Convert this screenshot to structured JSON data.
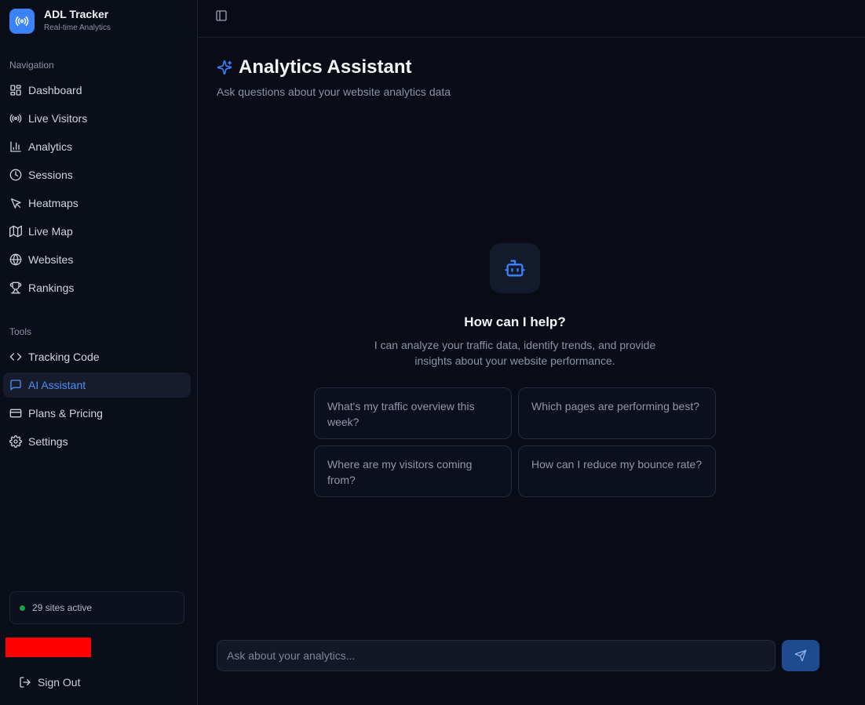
{
  "brand": {
    "name": "ADL Tracker",
    "subtitle": "Real-time Analytics"
  },
  "sidebar": {
    "navigation_label": "Navigation",
    "nav_items": [
      {
        "label": "Dashboard",
        "icon": "grid-icon"
      },
      {
        "label": "Live Visitors",
        "icon": "radio-icon"
      },
      {
        "label": "Analytics",
        "icon": "bar-chart-icon"
      },
      {
        "label": "Sessions",
        "icon": "clock-icon"
      },
      {
        "label": "Heatmaps",
        "icon": "cursor-icon"
      },
      {
        "label": "Live Map",
        "icon": "map-icon"
      },
      {
        "label": "Websites",
        "icon": "globe-icon"
      },
      {
        "label": "Rankings",
        "icon": "trophy-icon"
      }
    ],
    "tools_label": "Tools",
    "tool_items": [
      {
        "label": "Tracking Code",
        "icon": "code-icon"
      },
      {
        "label": "AI Assistant",
        "icon": "message-icon",
        "active": true
      },
      {
        "label": "Plans & Pricing",
        "icon": "credit-card-icon"
      },
      {
        "label": "Settings",
        "icon": "gear-icon"
      }
    ],
    "sites_status": "29 sites active",
    "redacted_user": "",
    "sign_out": "Sign Out"
  },
  "main": {
    "title": "Analytics Assistant",
    "subtitle": "Ask questions about your website analytics data",
    "empty_state": {
      "heading": "How can I help?",
      "description": "I can analyze your traffic data, identify trends, and provide insights about your website performance."
    },
    "suggestions": [
      "What's my traffic overview this week?",
      "Which pages are performing best?",
      "Where are my visitors coming from?",
      "How can I reduce my bounce rate?"
    ],
    "input": {
      "placeholder": "Ask about your analytics..."
    }
  },
  "colors": {
    "background": "#090c16",
    "accent": "#3b82f6",
    "active_text": "#4f8df5",
    "status_green": "#16a34a",
    "send_button": "#1e4a8f"
  }
}
